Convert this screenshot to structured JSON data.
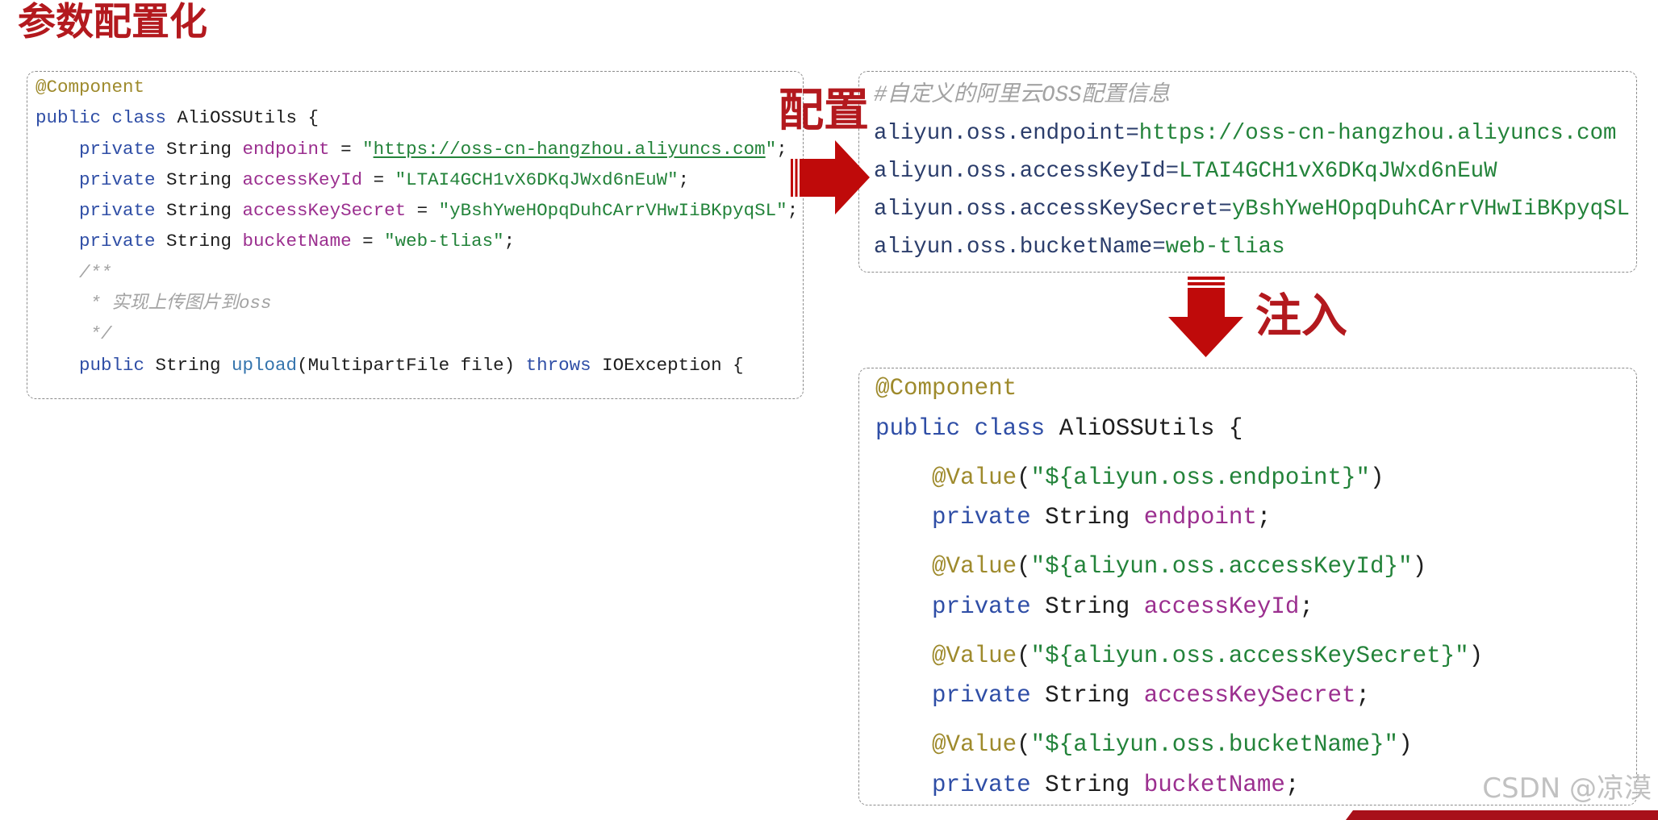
{
  "colors": {
    "accent_red": "#b3191e",
    "arrow_red": "#bf0a0a",
    "keyword_blue": "#2f4ea6",
    "field_purple": "#9b2f8f",
    "string_green": "#23833a",
    "annotation_gold": "#9e8a2c",
    "comment_gray": "#a3a3a3",
    "config_key": "#2b3d6b",
    "method_blue": "#3474ad",
    "banner_red": "#a8101a"
  },
  "header": {
    "title": "参数配置化"
  },
  "labels": {
    "configure": "配置",
    "inject": "注入"
  },
  "icons": {
    "configure_arrow": "arrow-right-icon",
    "inject_arrow": "arrow-down-icon"
  },
  "source_code": {
    "lines": [
      [
        "@Component"
      ],
      [
        "public class",
        " AliOSSUtils {"
      ],
      [
        "private",
        " String ",
        "endpoint",
        " = ",
        "\"",
        "https://oss-cn-hangzhou.aliyuncs.com",
        "\"",
        ";"
      ],
      [
        "private",
        " String ",
        "accessKeyId",
        " = ",
        "\"LTAI4GCH1vX6DKqJWxd6nEuW\"",
        ";"
      ],
      [
        "private",
        " String ",
        "accessKeySecret",
        " = ",
        "\"yBshYweHOpqDuhCArrVHwIiBKpyqSL\"",
        ";"
      ],
      [
        "private",
        " String ",
        "bucketName",
        " = ",
        "\"web-tlias\"",
        ";"
      ],
      [
        "/**"
      ],
      [
        " * 实现上传图片到oss"
      ],
      [
        " */"
      ],
      [
        "public",
        " String ",
        "upload",
        "(MultipartFile file) ",
        "throws",
        " IOException {"
      ]
    ]
  },
  "config_file": {
    "comment": "#自定义的阿里云OSS配置信息",
    "separator": "=",
    "entries": [
      {
        "key": "aliyun.oss.endpoint",
        "value": "https://oss-cn-hangzhou.aliyuncs.com"
      },
      {
        "key": "aliyun.oss.accessKeyId",
        "value": "LTAI4GCH1vX6DKqJWxd6nEuW"
      },
      {
        "key": "aliyun.oss.accessKeySecret",
        "value": "yBshYweHOpqDuhCArrVHwIiBKpyqSL"
      },
      {
        "key": "aliyun.oss.bucketName",
        "value": "web-tlias"
      }
    ]
  },
  "injected_code": {
    "lines": [
      [
        "@Component"
      ],
      [
        "public class",
        " AliOSSUtils {"
      ],
      [
        "@Value",
        "(",
        "\"${aliyun.oss.endpoint}\"",
        ")"
      ],
      [
        "private",
        " String ",
        "endpoint",
        ";"
      ],
      [
        "@Value",
        "(",
        "\"${aliyun.oss.accessKeyId}\"",
        ")"
      ],
      [
        "private",
        " String ",
        "accessKeyId",
        ";"
      ],
      [
        "@Value",
        "(",
        "\"${aliyun.oss.accessKeySecret}\"",
        ")"
      ],
      [
        "private",
        " String ",
        "accessKeySecret",
        ";"
      ],
      [
        "@Value",
        "(",
        "\"${aliyun.oss.bucketName}\"",
        ")"
      ],
      [
        "private",
        " String ",
        "bucketName",
        ";"
      ]
    ]
  },
  "watermark": {
    "text": "CSDN @凉漠"
  }
}
